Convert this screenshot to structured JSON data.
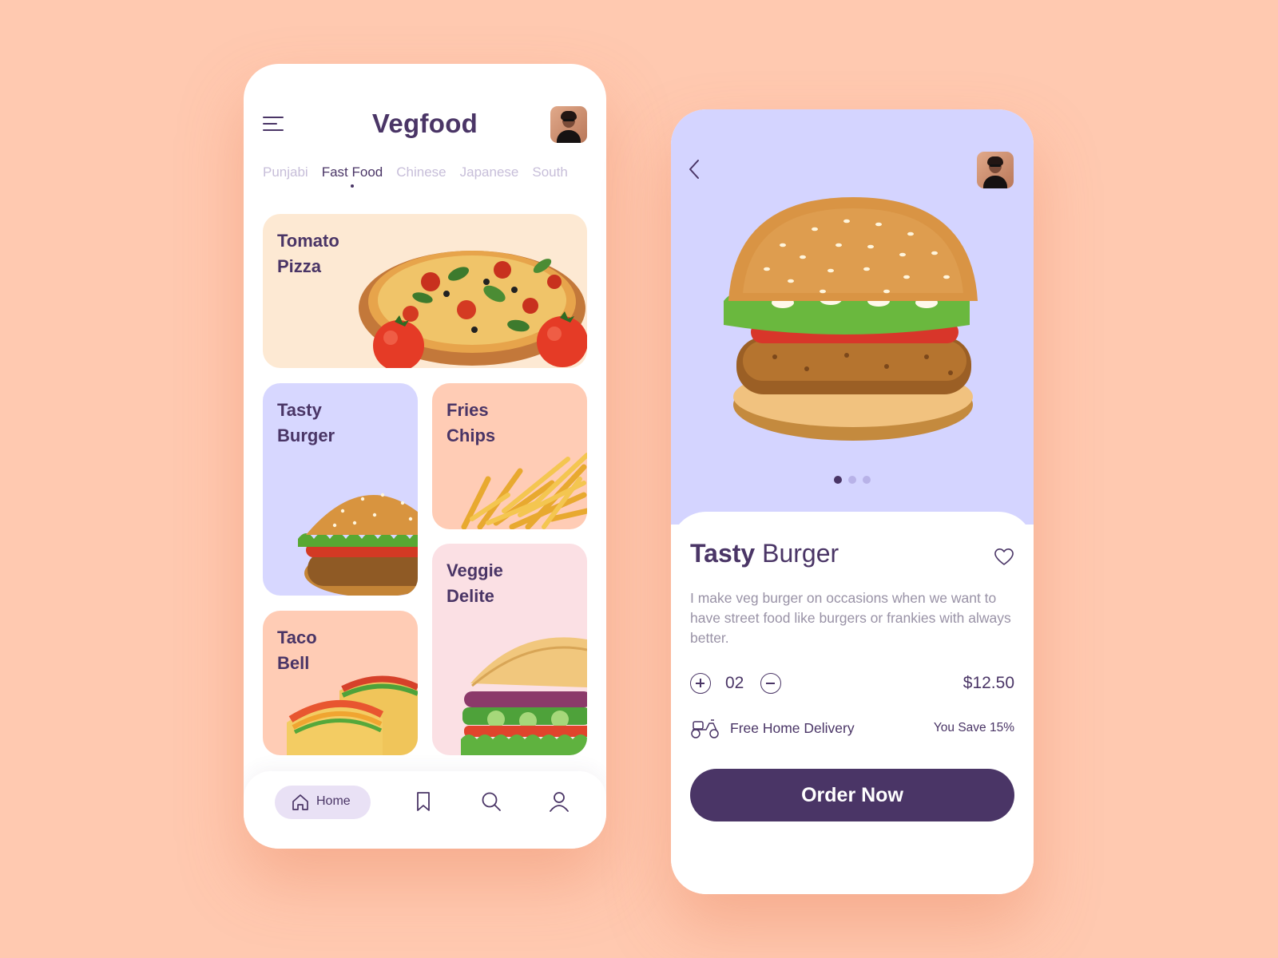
{
  "colors": {
    "background": "#ffc9b0",
    "brand_purple": "#4a3566",
    "hero_lavender": "#d4d4ff",
    "card_cream": "#fde9d3",
    "card_peach": "#ffccb5",
    "card_pink": "#fbe0e4",
    "muted_text": "#9992a6"
  },
  "home": {
    "title": "Vegfood",
    "menu_icon": "hamburger-menu-icon",
    "avatar": "profile-avatar",
    "tabs": [
      {
        "label": "Punjabi",
        "active": false
      },
      {
        "label": "Fast Food",
        "active": true
      },
      {
        "label": "Chinese",
        "active": false
      },
      {
        "label": "Japanese",
        "active": false
      },
      {
        "label": "South",
        "active": false
      }
    ],
    "cards": {
      "pizza": {
        "title": "Tomato\nPizza",
        "image": "pizza-with-tomatoes"
      },
      "burger": {
        "title": "Tasty\nBurger",
        "image": "veg-burger"
      },
      "fries": {
        "title": "Fries\nChips",
        "image": "french-fries"
      },
      "veggie": {
        "title": "Veggie\nDelite",
        "image": "veggie-sandwich"
      },
      "taco": {
        "title": "Taco\nBell",
        "image": "tacos"
      }
    },
    "nav": {
      "home_label": "Home",
      "icons": [
        "home-icon",
        "bookmark-icon",
        "search-icon",
        "user-icon"
      ]
    }
  },
  "detail": {
    "title_bold": "Tasty",
    "title_rest": " Burger",
    "description": "I make veg burger on occasions when we want to have street food like burgers or frankies with always better.",
    "quantity": "02",
    "price": "$12.50",
    "delivery_text": "Free Home Delivery",
    "save_text": "You Save 15%",
    "order_button": "Order Now",
    "carousel": {
      "count": 3,
      "active_index": 0
    },
    "icons": [
      "back-chevron-icon",
      "heart-icon",
      "plus-icon",
      "minus-icon",
      "scooter-icon"
    ]
  }
}
